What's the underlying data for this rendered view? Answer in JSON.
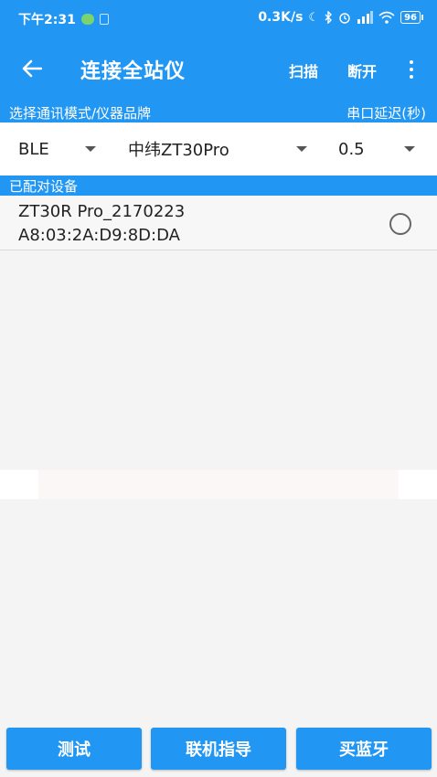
{
  "colors": {
    "primary": "#2196F3",
    "background": "#f4f4f4"
  },
  "status_bar": {
    "time": "下午2:31",
    "network_speed": "0.3K/s",
    "battery": "96"
  },
  "toolbar": {
    "title": "连接全站仪",
    "scan_label": "扫描",
    "disconnect_label": "断开"
  },
  "section_labels": {
    "mode_brand": "选择通讯模式/仪器品牌",
    "delay": "串口延迟(秒)"
  },
  "selectors": {
    "mode": "BLE",
    "brand": "中纬ZT30Pro",
    "delay": "0.5"
  },
  "paired": {
    "header": "已配对设备",
    "devices": [
      {
        "name": "ZT30R Pro_2170223",
        "mac": "A8:03:2A:D9:8D:DA"
      }
    ]
  },
  "bottom_buttons": {
    "test": "测试",
    "guide": "联机指导",
    "buy": "买蓝牙"
  },
  "icons": [
    "back-arrow-icon",
    "more-vert-icon",
    "dropdown-caret-icon",
    "radio-unchecked-icon",
    "wechat-icon",
    "moon-icon",
    "bluetooth-icon",
    "alarm-icon",
    "signal-icon",
    "wifi-icon",
    "battery-icon"
  ]
}
